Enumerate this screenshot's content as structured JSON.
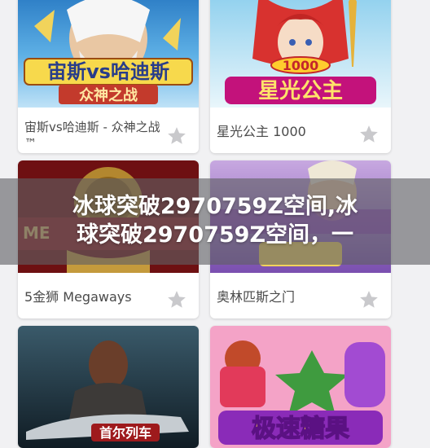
{
  "games": [
    {
      "name": "宙斯vs哈迪斯 - 众神之战 ™",
      "thumb_title": "宙斯vs哈迪斯",
      "thumb_subtitle": "众神之战",
      "thumb_tm": "™"
    },
    {
      "name": "星光公主 1000",
      "thumb_title": "星光公主",
      "thumb_badge": "1000"
    },
    {
      "name": "5金狮 Megaways",
      "thumb_title": "ME"
    },
    {
      "name": "奥林匹斯之门"
    },
    {
      "name": "",
      "thumb_title": "首尔列车"
    },
    {
      "name": "",
      "thumb_title": "极速糖果"
    }
  ],
  "banner": {
    "line1": "冰球突破2970759Z空间,冰",
    "line2": "球突破2970759Z空间，一"
  },
  "icons": {
    "favorite": "star-icon"
  },
  "colors": {
    "star": "#c9c9cc",
    "banner_overlay": "#5f5f64",
    "card_text": "#4a4a4a"
  }
}
